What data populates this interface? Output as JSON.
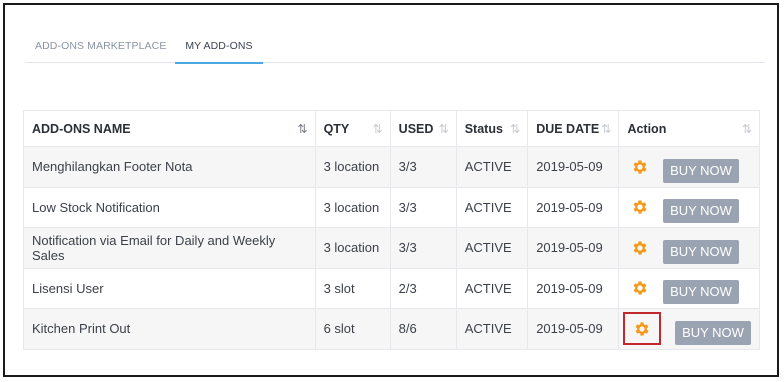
{
  "tabs": [
    {
      "label": "ADD-ONS MARKETPLACE",
      "active": false
    },
    {
      "label": "MY ADD-ONS",
      "active": true
    }
  ],
  "table": {
    "columns": [
      "ADD-ONS NAME",
      "QTY",
      "USED",
      "Status",
      "DUE DATE",
      "Action"
    ],
    "rows": [
      {
        "name": "Menghilangkan Footer Nota",
        "qty": "3 location",
        "used": "3/3",
        "status": "ACTIVE",
        "due": "2019-05-09",
        "button": "BUY NOW"
      },
      {
        "name": "Low Stock Notification",
        "qty": "3 location",
        "used": "3/3",
        "status": "ACTIVE",
        "due": "2019-05-09",
        "button": "BUY NOW"
      },
      {
        "name": "Notification via Email for Daily and Weekly Sales",
        "qty": "3 location",
        "used": "3/3",
        "status": "ACTIVE",
        "due": "2019-05-09",
        "button": "BUY NOW"
      },
      {
        "name": "Lisensi User",
        "qty": "3 slot",
        "used": "2/3",
        "status": "ACTIVE",
        "due": "2019-05-09",
        "button": "BUY NOW"
      },
      {
        "name": "Kitchen Print Out",
        "qty": "6 slot",
        "used": "8/6",
        "status": "ACTIVE",
        "due": "2019-05-09",
        "button": "BUY NOW"
      }
    ]
  },
  "colors": {
    "gear": "#f39a1c",
    "button": "#9aa3b1",
    "tab_underline": "#4aa8e0",
    "highlight": "#c0282d"
  },
  "icons": {
    "settings": "gear-icon",
    "sort": "sort-icon"
  }
}
